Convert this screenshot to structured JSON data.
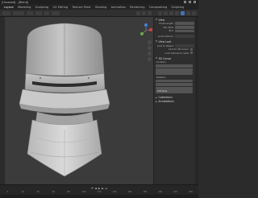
{
  "window": {
    "title": "[Unsaved] - [Blend]"
  },
  "menubar": {
    "items": [
      "Layout",
      "Modeling",
      "Sculpting",
      "UV Editing",
      "Texture Paint",
      "Shading",
      "Animation",
      "Rendering",
      "Compositing",
      "Scripting"
    ]
  },
  "npanel": {
    "view": {
      "title": "View",
      "rows": [
        "Focal Length",
        "Clip Start",
        "End",
        "Local Camera"
      ],
      "view_lock": "View Lock",
      "lock_to_object": "Lock to Object",
      "lock_to_3d_cursor": "Lock to 3D Cursor",
      "lock_camera_to_view": "Lock Camera to View"
    },
    "cursor": {
      "title": "3D Cursor",
      "location": "Location",
      "rotation": "Rotation",
      "mode": "XYZ Euler"
    },
    "collections": "Collections",
    "annotations": "Annotations"
  },
  "timeline": {
    "ticks": [
      "0",
      "20",
      "40",
      "60",
      "80",
      "100",
      "120",
      "140",
      "160",
      "180",
      "200",
      "220",
      "240"
    ]
  },
  "colors": {
    "accent": "#4772b3",
    "helmet": "#bdbdbd"
  }
}
